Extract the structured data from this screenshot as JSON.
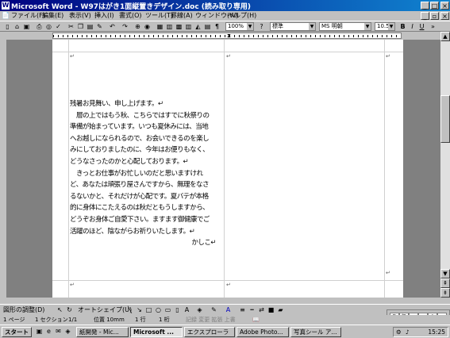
{
  "window": {
    "title": "Microsoft Word - W97はがき1面縦置きデザイン.doc (読み取り専用)",
    "app_icon": "W"
  },
  "menu": [
    "ファイル(F)",
    "編集(E)",
    "表示(V)",
    "挿入(I)",
    "書式(O)",
    "ツール(T)",
    "罫線(A)",
    "ウィンドウ(W)",
    "ヘルプ(H)"
  ],
  "toolbar": {
    "zoom": "100%",
    "style": "標準",
    "font": "MS 明朝",
    "size": "10.5",
    "bold": "B",
    "italic": "I",
    "underline": "U"
  },
  "document": {
    "lines": [
      "残暑お見舞い、申し上げます。↵",
      "　層の上ではもう秋、こちらではすでに秋祭りの",
      "準備が始まっています。いつも夏休みには、当地",
      "へお越しになられるので、お会いできるのを楽し",
      "みにしておりましたのに、今年はお便りもなく、",
      "どうなさったのかと心配しております。↵",
      "　きっとお仕事がお忙しいのだと思いますけれ",
      "ど、あなたは頑張り屋さんですから、無理をなさ",
      "るないかと、それだけが心配です。夏バテが本格",
      "的に身体にこたえるのは秋だともうしますから、",
      "どうぞお身体ご自愛下さい。ますます御健康でご",
      "活躍のほど、陰ながらお祈りいたします。↵"
    ],
    "closing": "かしこ↵",
    "para_mark": "↵"
  },
  "drawing_toolbar": {
    "draw_label": "図形の調整(D)",
    "autoshape_label": "オートシェイプ(U)"
  },
  "status": {
    "page": "1 ページ",
    "section": "1 セクション",
    "pages": "1/1",
    "position": "位置 10mm",
    "line": "1 行",
    "column": "1 桁",
    "flags": "記録 変更 拡張 上書"
  },
  "taskbar": {
    "start_label": "スタート",
    "items": [
      "紙開発 - Mic...",
      "Microsoft ...",
      "エクスプローラ",
      "Adobe Photo...",
      "写真シール ア..."
    ],
    "active_index": 1,
    "clock": "15:25"
  },
  "colors": {
    "title_start": "#000080",
    "title_end": "#1084d0",
    "chrome": "#c0c0c0"
  }
}
